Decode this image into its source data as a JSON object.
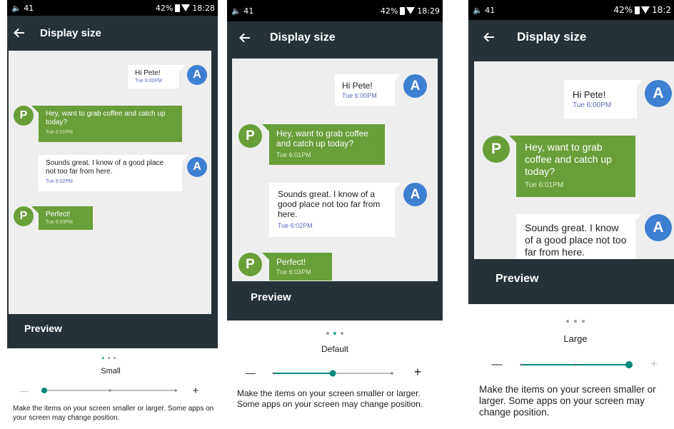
{
  "screens": [
    {
      "status": {
        "notification": "41",
        "battery": "42%",
        "time": "18:28"
      },
      "app_bar": {
        "title": "Display size"
      },
      "messages": [
        {
          "text": "Hi Pete!",
          "time": "Tue 6:00PM",
          "sender": "A"
        },
        {
          "text": "Hey, want to grab coffee and catch up today?",
          "time": "Tue 6:01PM",
          "sender": "P"
        },
        {
          "text": "Sounds great. I know of a good place not too far from here.",
          "time": "Tue 6:02PM",
          "sender": "A"
        },
        {
          "text": "Perfect!",
          "time": "Tue 6:03PM",
          "sender": "P"
        }
      ],
      "preview_label": "Preview",
      "pager": {
        "pages": 3,
        "active": 1
      },
      "size_label": "Small",
      "slider": {
        "position": 0,
        "steps": 4
      },
      "minus": "—",
      "plus": "+",
      "description": "Make the items on your screen smaller or larger. Some apps on your screen may change position."
    },
    {
      "status": {
        "notification": "41",
        "battery": "42%",
        "time": "18:29"
      },
      "app_bar": {
        "title": "Display size"
      },
      "messages": [
        {
          "text": "Hi Pete!",
          "time": "Tue 6:00PM",
          "sender": "A"
        },
        {
          "text": "Hey, want to grab coffee and catch up today?",
          "time": "Tue 6:01PM",
          "sender": "P"
        },
        {
          "text": "Sounds great. I know of a good place not too far from here.",
          "time": "Tue 6:02PM",
          "sender": "A"
        },
        {
          "text": "Perfect!",
          "time": "Tue 6:03PM",
          "sender": "P"
        }
      ],
      "preview_label": "Preview",
      "pager": {
        "pages": 3,
        "active": 2
      },
      "size_label": "Default",
      "slider": {
        "position": 1,
        "steps": 4
      },
      "minus": "—",
      "plus": "+",
      "description": "Make the items on your screen smaller or larger. Some apps on your screen may change position."
    },
    {
      "status": {
        "notification": "41",
        "battery": "42%",
        "time": "18:2"
      },
      "app_bar": {
        "title": "Display size"
      },
      "messages": [
        {
          "text": "Hi Pete!",
          "time": "Tue 6:00PM",
          "sender": "A"
        },
        {
          "text": "Hey, want to grab coffee and catch up today?",
          "time": "Tue 6:01PM",
          "sender": "P"
        },
        {
          "text": "Sounds great. I know of a good place not too far from here.",
          "time": "",
          "sender": "A"
        }
      ],
      "preview_label": "Preview",
      "pager": {
        "pages": 3,
        "active": 3
      },
      "size_label": "Large",
      "slider": {
        "position": 2,
        "steps": 3
      },
      "minus": "—",
      "plus": "+",
      "description": "Make the items on your screen smaller or larger. Some apps on your screen may change position."
    }
  ],
  "colors": {
    "app_bar": "#263238",
    "accent": "#00897b",
    "bubble_green": "#689f38",
    "avatar_a": "#3d7fd1",
    "avatar_p": "#689f38"
  }
}
